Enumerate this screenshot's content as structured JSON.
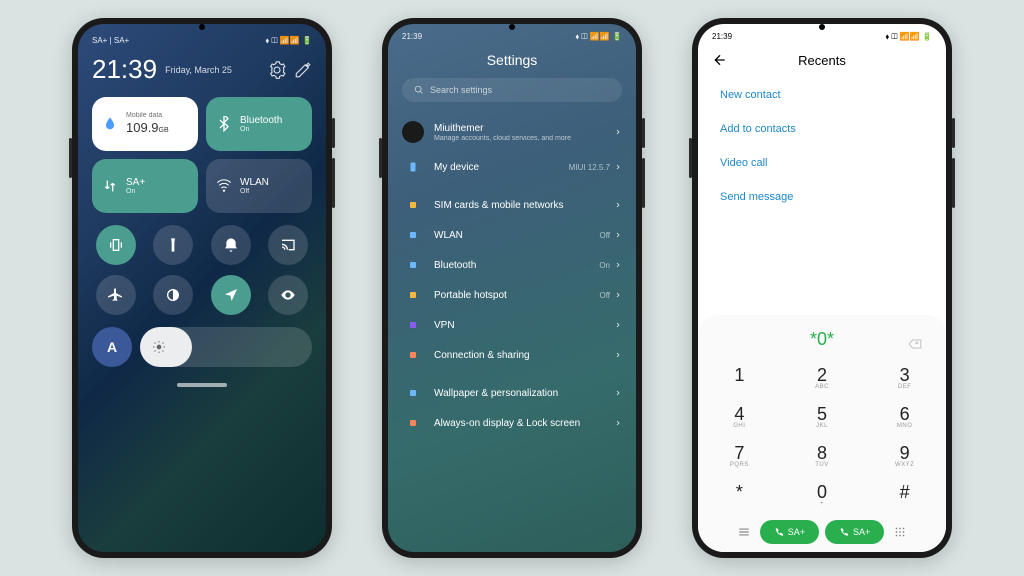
{
  "status": {
    "carrier": "SA+ | SA+",
    "time_small": "21:39",
    "icons": "⬧ ◫ 📶📶 🔋"
  },
  "cc": {
    "time": "21:39",
    "date": "Friday, March 25",
    "tile_data": {
      "label": "Mobile data",
      "value": "109.9",
      "unit": "GB"
    },
    "tile_bt": {
      "label": "Bluetooth",
      "sub": "On"
    },
    "tile_sa": {
      "label": "SA+",
      "sub": "On"
    },
    "tile_wlan": {
      "label": "WLAN",
      "sub": "Off"
    },
    "auto": "A"
  },
  "settings": {
    "title": "Settings",
    "search": "Search settings",
    "account": {
      "name": "Miuithemer",
      "sub": "Manage accounts, cloud services, and more"
    },
    "device": {
      "label": "My device",
      "value": "MIUI 12.5.7"
    },
    "items": [
      {
        "label": "SIM cards & mobile networks",
        "value": ""
      },
      {
        "label": "WLAN",
        "value": "Off"
      },
      {
        "label": "Bluetooth",
        "value": "On"
      },
      {
        "label": "Portable hotspot",
        "value": "Off"
      },
      {
        "label": "VPN",
        "value": ""
      },
      {
        "label": "Connection & sharing",
        "value": ""
      }
    ],
    "items2": [
      {
        "label": "Wallpaper & personalization"
      },
      {
        "label": "Always-on display & Lock screen"
      }
    ]
  },
  "dialer": {
    "title": "Recents",
    "menu": [
      "New contact",
      "Add to contacts",
      "Video call",
      "Send message"
    ],
    "number": "*0*",
    "keys": [
      {
        "n": "1",
        "l": ""
      },
      {
        "n": "2",
        "l": "ABC"
      },
      {
        "n": "3",
        "l": "DEF"
      },
      {
        "n": "4",
        "l": "GHI"
      },
      {
        "n": "5",
        "l": "JKL"
      },
      {
        "n": "6",
        "l": "MNO"
      },
      {
        "n": "7",
        "l": "PQRS"
      },
      {
        "n": "8",
        "l": "TUV"
      },
      {
        "n": "9",
        "l": "WXYZ"
      },
      {
        "n": "*",
        "l": ""
      },
      {
        "n": "0",
        "l": "+"
      },
      {
        "n": "#",
        "l": ""
      }
    ],
    "call1": "SA+",
    "call2": "SA+"
  }
}
